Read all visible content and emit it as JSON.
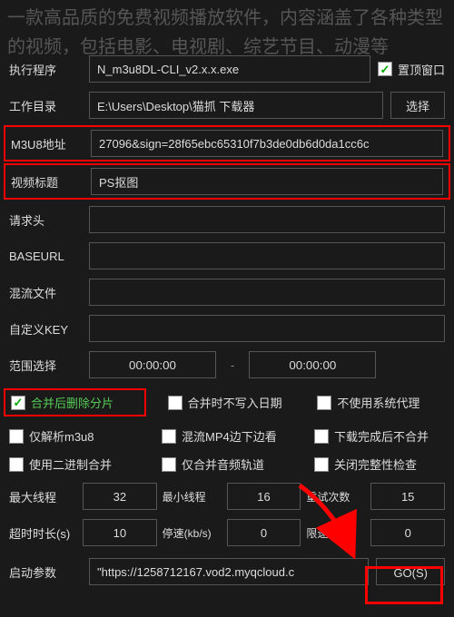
{
  "overlay_text": "一款高品质的免费视频播放软件，内容涵盖了各种类型的视频，包括电影、电视剧、综艺节目、动漫等",
  "top": {
    "exec_label": "执行程序",
    "exec_value": "N_m3u8DL-CLI_v2.x.x.exe",
    "checkbox_label": "置顶窗口",
    "workdir_label": "工作目录",
    "workdir_value": "E:\\Users\\Desktop\\猫抓 下载器",
    "select_btn": "选择"
  },
  "fields": {
    "m3u8_label": "M3U8地址",
    "m3u8_value": "27096&sign=28f65ebc65310f7b3de0db6d0da1cc6c",
    "title_label": "视频标题",
    "title_value": "PS抠图",
    "header_label": "请求头",
    "header_value": "",
    "baseurl_label": "BASEURL",
    "baseurl_value": "",
    "mux_label": "混流文件",
    "mux_value": "",
    "key_label": "自定义KEY",
    "key_value": "",
    "range_label": "范围选择",
    "range_from": "00:00:00",
    "range_to": "00:00:00"
  },
  "checks": {
    "c1": "合并后删除分片",
    "c2": "合并时不写入日期",
    "c3": "不使用系统代理",
    "c4": "仅解析m3u8",
    "c5": "混流MP4边下边看",
    "c6": "下载完成后不合并",
    "c7": "使用二进制合并",
    "c8": "仅合并音频轨道",
    "c9": "关闭完整性检查"
  },
  "nums": {
    "max_thread_label": "最大线程",
    "max_thread": "32",
    "min_thread_label": "最小线程",
    "min_thread": "16",
    "retry_label": "重试次数",
    "retry": "15",
    "timeout_label": "超时时长(s)",
    "timeout": "10",
    "stop_label": "停速(kb/s)",
    "stop": "0",
    "limit_label": "限速(kb/s)",
    "limit": "0"
  },
  "bottom": {
    "args_label": "启动参数",
    "args_value": "\"https://1258712167.vod2.myqcloud.c",
    "go": "GO(S)"
  }
}
